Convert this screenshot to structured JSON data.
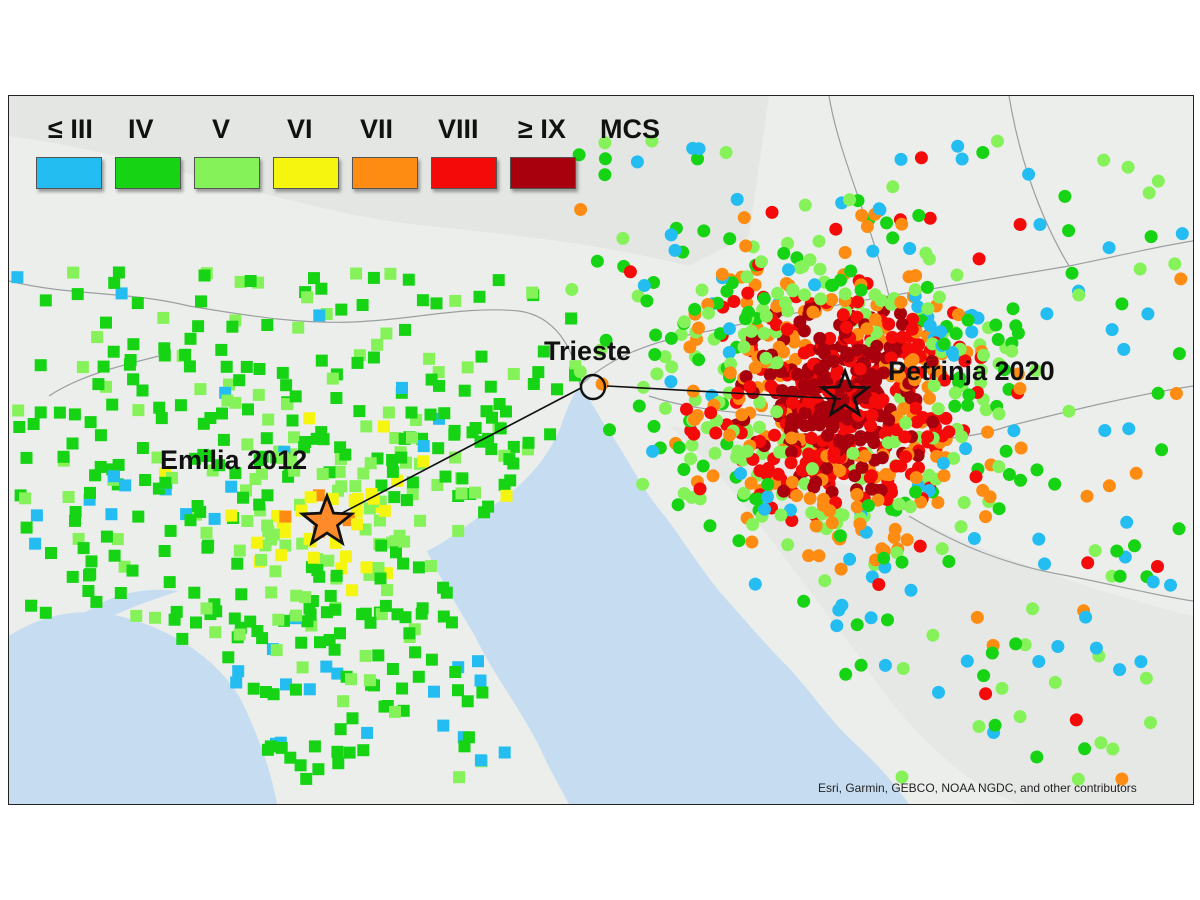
{
  "legend": {
    "labels": [
      "≤ III",
      "IV",
      "V",
      "VI",
      "VII",
      "VIII",
      "≥ IX"
    ],
    "colors": [
      "#24bdf2",
      "#16d414",
      "#86f25a",
      "#f5f50f",
      "#ff8c12",
      "#f50a0a",
      "#a8000c"
    ],
    "scale_label": "MCS"
  },
  "labels": {
    "trieste": "Trieste",
    "emilia": "Emilia 2012",
    "petrinja": "Petrinja 2020"
  },
  "attribution": "Esri, Garmin, GEBCO, NOAA NGDC, and other contributors",
  "map_colors": {
    "land": "#eceeec",
    "sea": "#c6ddf1",
    "border": "#9aa0a0",
    "alps": "#e4e7e4",
    "epicenter_emilia": "#ff8a2a"
  }
}
